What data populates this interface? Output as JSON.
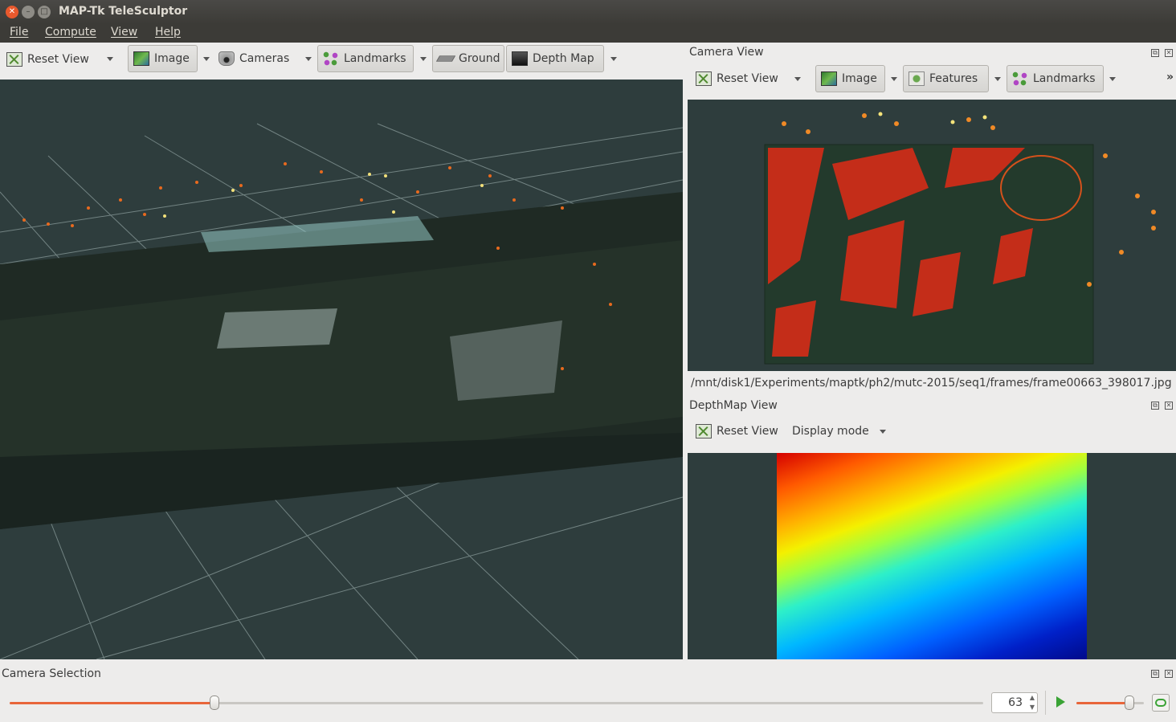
{
  "window": {
    "title": "MAP-Tk TeleSculptor"
  },
  "menu": [
    "File",
    "Compute",
    "View",
    "Help"
  ],
  "world_toolbar": {
    "reset_view": "Reset View",
    "image": "Image",
    "cameras": "Cameras",
    "landmarks": "Landmarks",
    "ground": "Ground",
    "depth_map": "Depth Map"
  },
  "camera_view": {
    "title": "Camera View",
    "reset_view": "Reset View",
    "image": "Image",
    "features": "Features",
    "landmarks": "Landmarks",
    "overflow": "»",
    "path": "/mnt/disk1/Experiments/maptk/ph2/mutc-2015/seq1/frames/frame00663_398017.jpg"
  },
  "depthmap_view": {
    "title": "DepthMap View",
    "reset_view": "Reset View",
    "display_mode": "Display mode"
  },
  "camera_selection": {
    "title": "Camera Selection",
    "frame": "63",
    "slider_fraction": 0.21,
    "speed_fraction": 0.78
  },
  "colors": {
    "viewport_bg": "#2e3d3d",
    "accent": "#e8653a",
    "close_button": "#e9592d"
  }
}
